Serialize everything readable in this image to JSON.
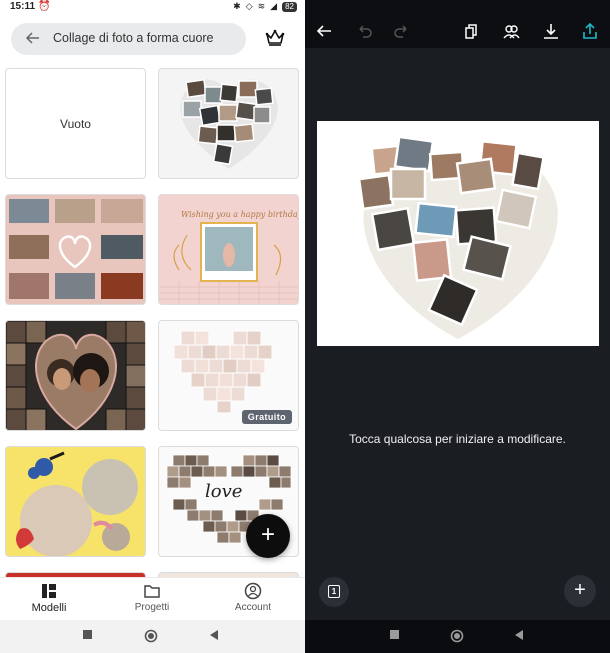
{
  "status": {
    "time": "15:11",
    "battery": "82"
  },
  "search": {
    "query": "Collage di foto a forma cuore"
  },
  "templates": {
    "empty_label": "Vuoto",
    "free_badge": "Gratuito",
    "birthday_text": "Wishing you a happy birthday!",
    "love_text": "love"
  },
  "bottom_nav": {
    "items": [
      {
        "label": "Modelli",
        "icon": "templates-grid-icon",
        "active": true
      },
      {
        "label": "Progetti",
        "icon": "folder-icon",
        "active": false
      },
      {
        "label": "Account",
        "icon": "account-icon",
        "active": false
      }
    ]
  },
  "editor": {
    "hint": "Tocca qualcosa per iniziare a modificare.",
    "page_number": "1"
  },
  "colors": {
    "editor_background": "#1a1d22",
    "editor_topbar": "#0d0e12",
    "fab": "#0d0d0d",
    "badge": "#5e6470",
    "search_field": "#e9eaec"
  }
}
